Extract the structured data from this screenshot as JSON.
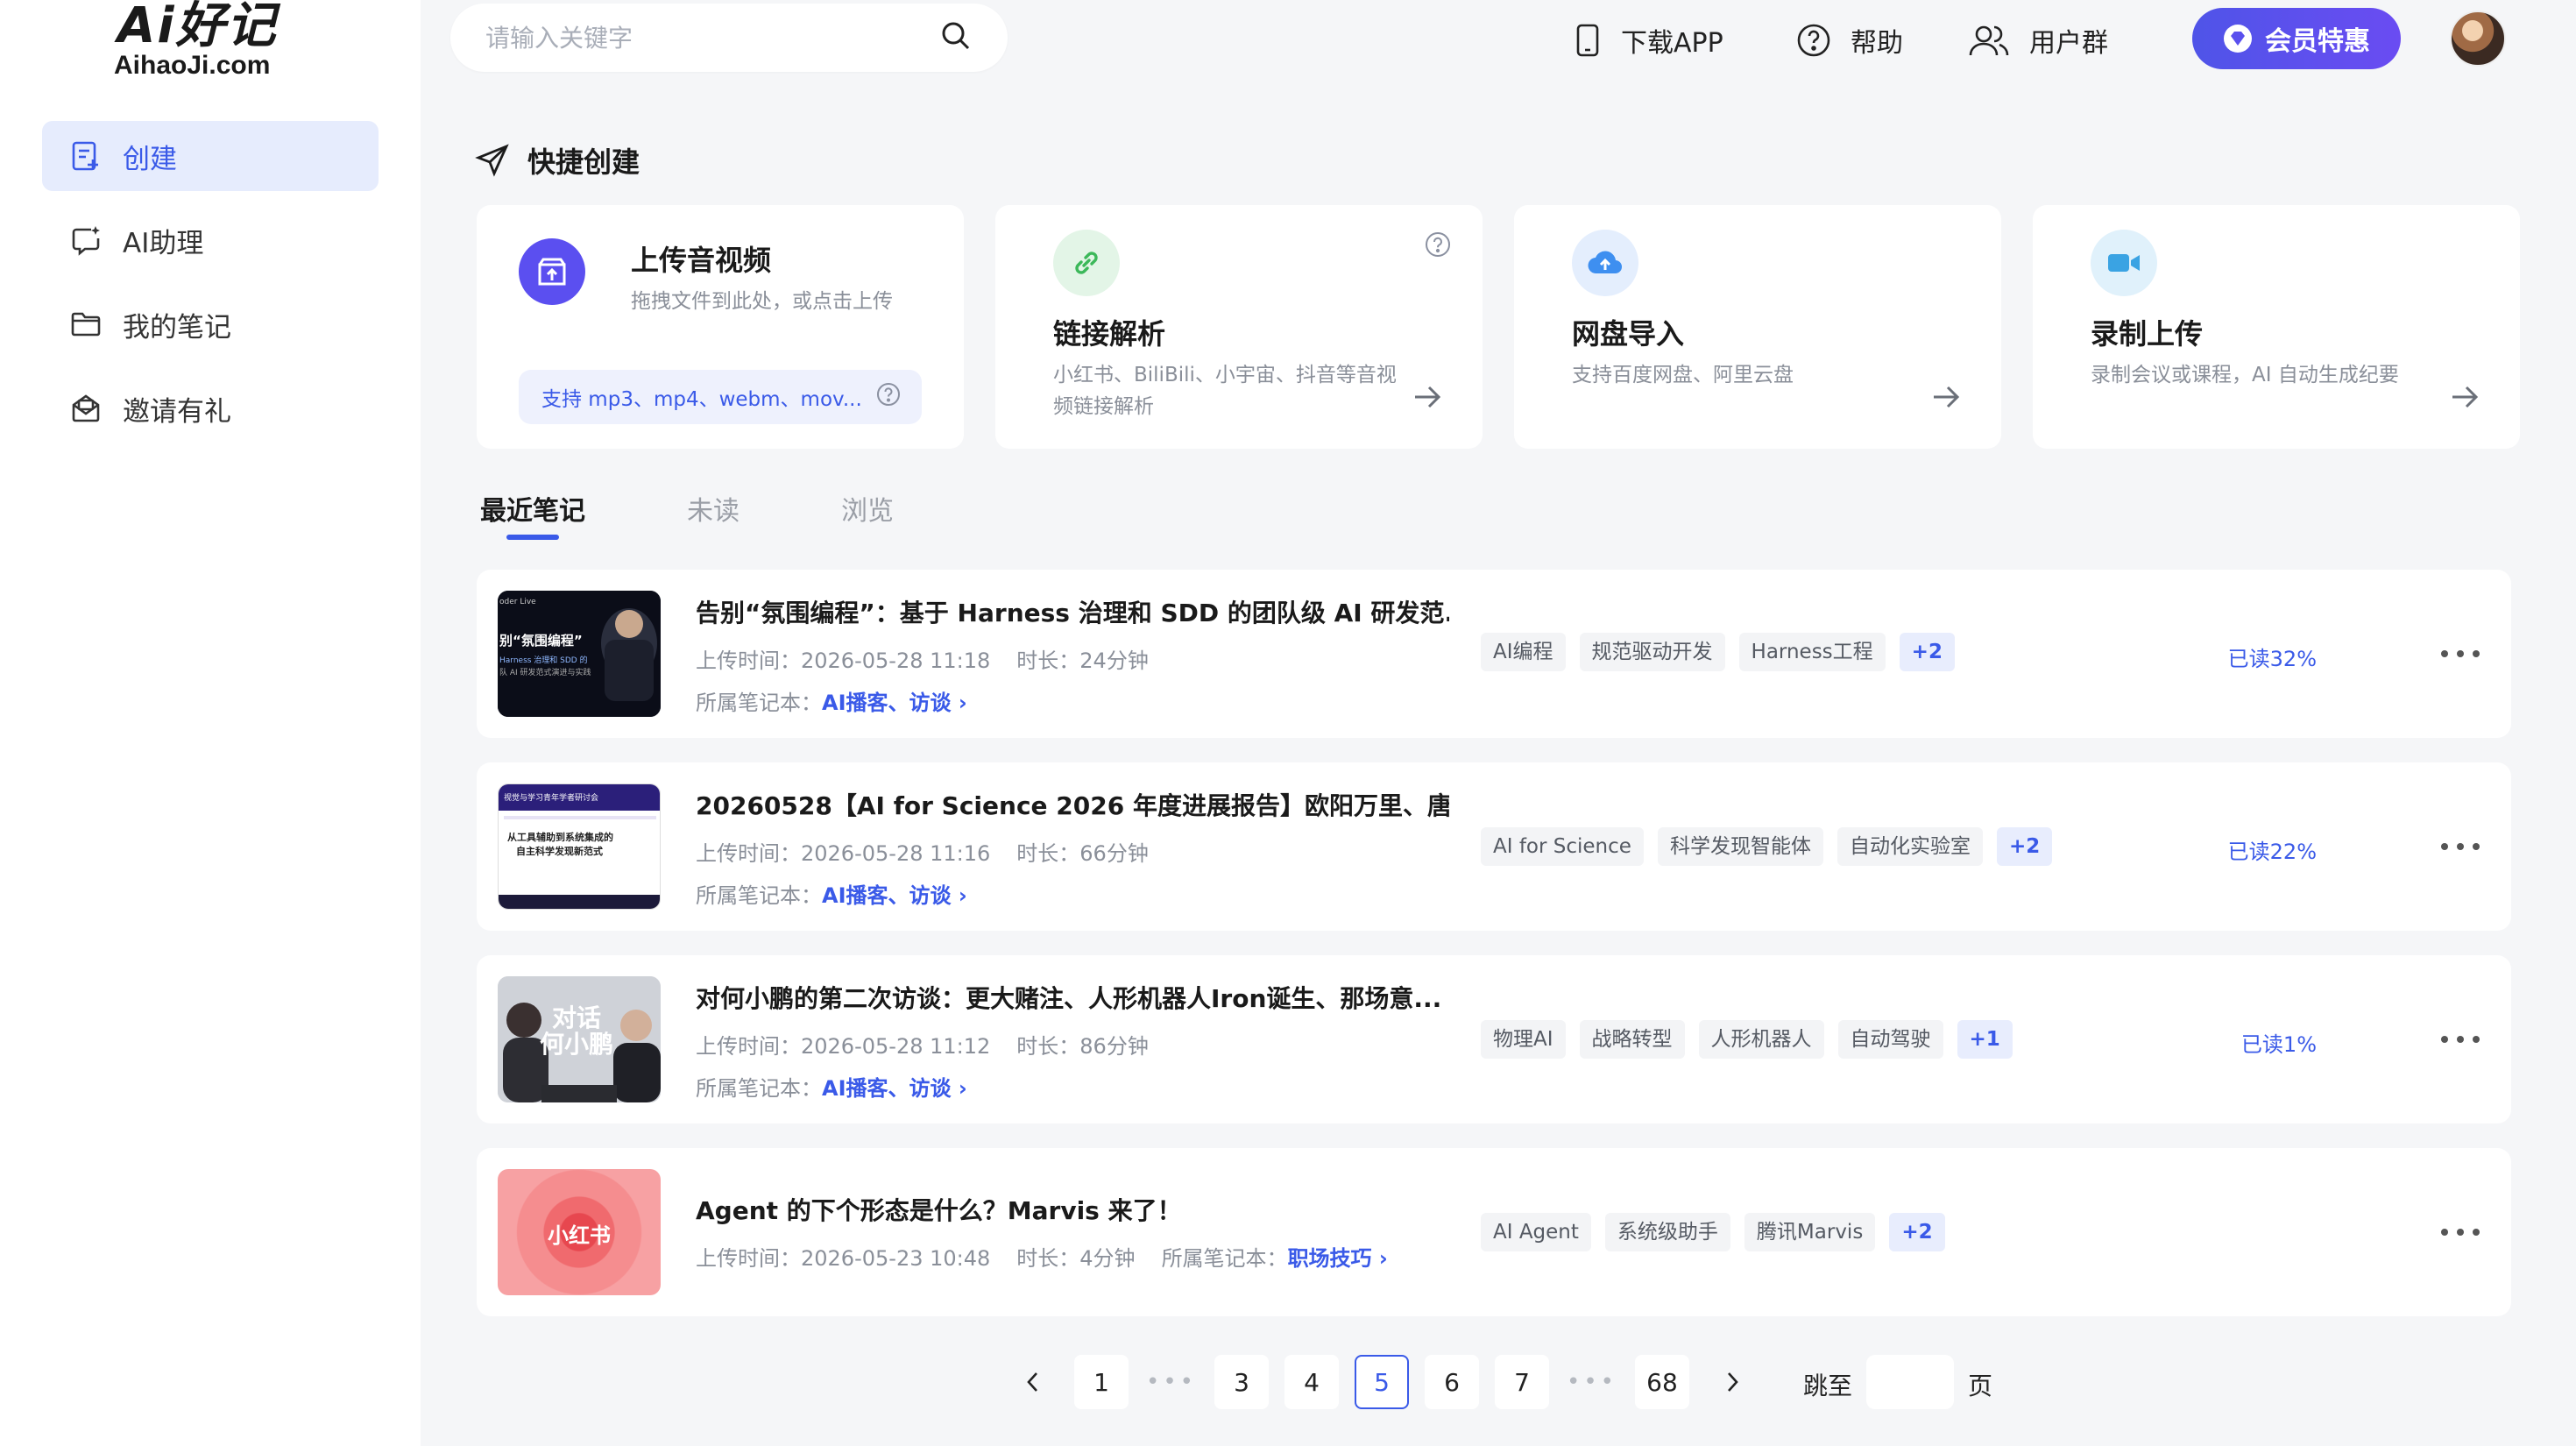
{
  "logo": {
    "main": "Ai好记",
    "sub": "AihaoJi.com"
  },
  "sidebar": {
    "items": [
      {
        "label": "创建"
      },
      {
        "label": "AI助理"
      },
      {
        "label": "我的笔记"
      },
      {
        "label": "邀请有礼"
      }
    ]
  },
  "search": {
    "placeholder": "请输入关键字"
  },
  "header": {
    "download": "下载APP",
    "help": "帮助",
    "group": "用户群",
    "vip": "会员特惠"
  },
  "quick_create": {
    "title": "快捷创建",
    "cards": [
      {
        "title": "上传音视频",
        "desc": "拖拽文件到此处，或点击上传",
        "support": "支持 mp3、mp4、webm、mov..."
      },
      {
        "title": "链接解析",
        "desc1": "小红书、BiliBili、小宇宙、抖音等音视",
        "desc2": "频链接解析"
      },
      {
        "title": "网盘导入",
        "desc": "支持百度网盘、阿里云盘"
      },
      {
        "title": "录制上传",
        "desc": "录制会议或课程，AI 自动生成纪要"
      }
    ]
  },
  "tabs": [
    "最近笔记",
    "未读",
    "浏览"
  ],
  "labels": {
    "upload_time": "上传时间：",
    "duration": "时长：",
    "notebook": "所属笔记本："
  },
  "notes": [
    {
      "title": "告别“氛围编程”：基于 Harness 治理和 SDD 的团队级 AI 研发范...",
      "time": "2026-05-28 11:18",
      "duration": "24分钟",
      "notebook": "AI播客、访谈",
      "tags": [
        "AI编程",
        "规范驱动开发",
        "Harness工程"
      ],
      "more": "+2",
      "progress": "已读32%",
      "thumb_text": [
        "oder Live",
        "别“氛围编程”",
        "Harness 治理和 SDD 的",
        "队 AI 研发范式演进与实践"
      ]
    },
    {
      "title": "20260528【AI for Science 2026 年度进展报告】欧阳万里、唐...",
      "time": "2026-05-28 11:16",
      "duration": "66分钟",
      "notebook": "AI播客、访谈",
      "tags": [
        "AI for Science",
        "科学发现智能体",
        "自动化实验室"
      ],
      "more": "+2",
      "progress": "已读22%",
      "thumb_text": [
        "视觉与学习青年学者研讨会",
        "从工具辅助到系统集成的",
        "自主科学发现新范式"
      ]
    },
    {
      "title": "对何小鹏的第二次访谈：更大赌注、人形机器人Iron诞生、那场意...",
      "time": "2026-05-28 11:12",
      "duration": "86分钟",
      "notebook": "AI播客、访谈",
      "tags": [
        "物理AI",
        "战略转型",
        "人形机器人",
        "自动驾驶"
      ],
      "more": "+1",
      "progress": "已读1%",
      "thumb_text": [
        "对话",
        "何小鹏"
      ]
    },
    {
      "title": "Agent 的下个形态是什么？Marvis 来了！",
      "time": "2026-05-23 10:48",
      "duration": "4分钟",
      "notebook": "职场技巧",
      "tags": [
        "AI Agent",
        "系统级助手",
        "腾讯Marvis"
      ],
      "more": "+2",
      "progress": "",
      "thumb_text": [
        "小红书"
      ]
    }
  ],
  "pagination": {
    "pages": [
      "1",
      "3",
      "4",
      "5",
      "6",
      "7",
      "68"
    ],
    "current": "5",
    "ellipsis": "•••",
    "jump_label": "跳至",
    "page_suffix": "页"
  },
  "colors": {
    "accent": "#3a5ae8",
    "vip_start": "#4f54e8",
    "vip_end": "#6a4cf2"
  }
}
